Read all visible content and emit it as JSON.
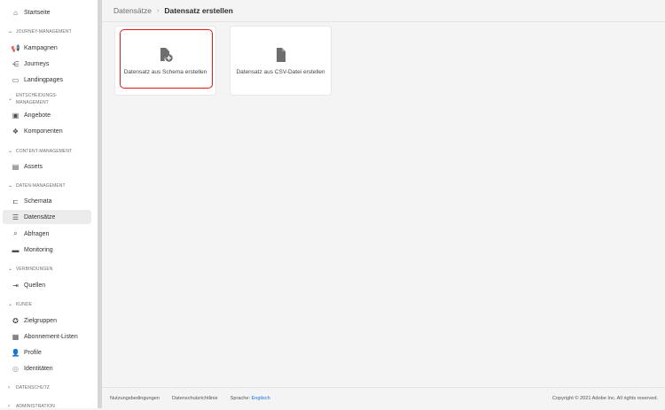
{
  "sidebar": {
    "startseite": "Startseite",
    "sections": {
      "journey": "JOURNEY-MANAGEMENT",
      "entscheidung1": "ENTSCHEIDUNGS-",
      "entscheidung2": "MANAGEMENT",
      "content": "CONTENT-MANAGEMENT",
      "daten": "DATEN-MANAGEMENT",
      "verbindungen": "VERBINDUNGEN",
      "kunde": "KUNDE",
      "datenschutz": "DATENSCHUTZ",
      "administration": "ADMINISTRATION"
    },
    "items": {
      "kampagnen": "Kampagnen",
      "journeys": "Journeys",
      "landingpages": "Landingpages",
      "angebote": "Angebote",
      "komponenten": "Komponenten",
      "assets": "Assets",
      "schemata": "Schemata",
      "datensaetze": "Datensätze",
      "abfragen": "Abfragen",
      "monitoring": "Monitoring",
      "quellen": "Quellen",
      "zielgruppen": "Zielgruppen",
      "abonnement": "Abonnement-Listen",
      "profile": "Profile",
      "identitaeten": "Identitäten"
    },
    "selected": "Datensätze"
  },
  "header": {
    "breadcrumb_parent": "Datensätze",
    "breadcrumb_separator": "›",
    "title": "Datensatz erstellen"
  },
  "cards": [
    {
      "label": "Datensatz aus Schema erstellen"
    },
    {
      "label": "Datensatz aus CSV-Datei erstellen"
    }
  ],
  "footer": {
    "terms": "Nutzungsbedingungen",
    "privacy": "Datenschutzrichtlinie",
    "language_label": "Sprache:",
    "language_value": "Englisch",
    "copyright": "Copyright © 2021 Adobe Inc. All rights reserved."
  },
  "colors": {
    "highlight": "#e01b1b",
    "link": "#1473e6"
  }
}
